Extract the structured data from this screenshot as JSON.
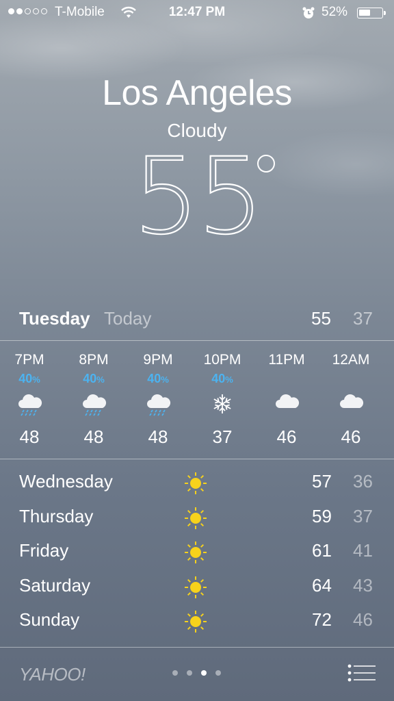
{
  "status_bar": {
    "signal_full": 2,
    "signal_total": 5,
    "carrier": "T-Mobile",
    "time": "12:47 PM",
    "battery": "52%",
    "battery_level": 0.52,
    "icons": [
      "wifi-icon",
      "alarm-icon",
      "battery-icon"
    ]
  },
  "current": {
    "city": "Los Angeles",
    "condition": "Cloudy",
    "temperature": "55"
  },
  "today": {
    "day": "Tuesday",
    "label": "Today",
    "high": "55",
    "low": "37"
  },
  "hourly": [
    {
      "time": "7PM",
      "pop": "40",
      "pop_unit": "%",
      "icon": "rain-cloud-icon",
      "temp": "48"
    },
    {
      "time": "8PM",
      "pop": "40",
      "pop_unit": "%",
      "icon": "rain-cloud-icon",
      "temp": "48"
    },
    {
      "time": "9PM",
      "pop": "40",
      "pop_unit": "%",
      "icon": "rain-cloud-icon",
      "temp": "48"
    },
    {
      "time": "10PM",
      "pop": "40",
      "pop_unit": "%",
      "icon": "snowflake-icon",
      "temp": "37"
    },
    {
      "time": "11PM",
      "pop": "",
      "pop_unit": "",
      "icon": "cloud-icon",
      "temp": "46"
    },
    {
      "time": "12AM",
      "pop": "",
      "pop_unit": "",
      "icon": "cloud-icon",
      "temp": "46"
    }
  ],
  "daily": [
    {
      "day": "Wednesday",
      "icon": "sun-icon",
      "high": "57",
      "low": "36"
    },
    {
      "day": "Thursday",
      "icon": "sun-icon",
      "high": "59",
      "low": "37"
    },
    {
      "day": "Friday",
      "icon": "sun-icon",
      "high": "61",
      "low": "41"
    },
    {
      "day": "Saturday",
      "icon": "sun-icon",
      "high": "64",
      "low": "43"
    },
    {
      "day": "Sunday",
      "icon": "sun-icon",
      "high": "72",
      "low": "46"
    }
  ],
  "footer": {
    "brand": "YAHOO!",
    "pages": 4,
    "active_page": 3,
    "menu_icon": "list-icon"
  },
  "colors": {
    "precip_blue": "#4cb3f0",
    "sun_yellow": "#f7d21c"
  }
}
